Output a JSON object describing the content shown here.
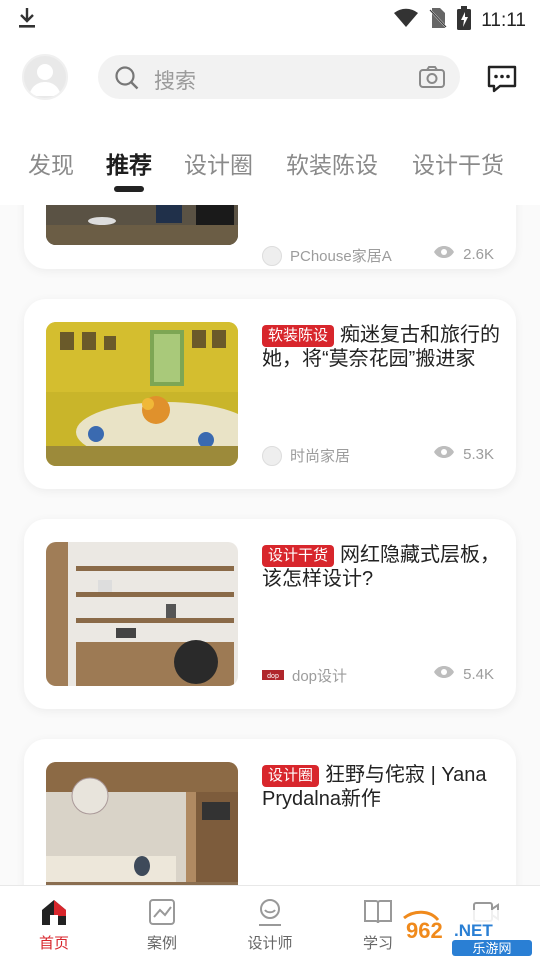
{
  "status_bar": {
    "time": "11:11"
  },
  "header": {
    "search_placeholder": "搜索"
  },
  "tabs": [
    {
      "label": "发现"
    },
    {
      "label": "推荐"
    },
    {
      "label": "设计圈"
    },
    {
      "label": "软装陈设"
    },
    {
      "label": "设计干货"
    }
  ],
  "feed": [
    {
      "source": "PChouse家居A",
      "views": "2.6K"
    },
    {
      "tag": "软装陈设",
      "title": "痴迷复古和旅行的她，将“莫奈花园”搬进家",
      "source": "时尚家居",
      "views": "5.3K"
    },
    {
      "tag": "设计干货",
      "title": "网红隐藏式层板，该怎样设计?",
      "source": "dop设计",
      "views": "5.4K"
    },
    {
      "tag": "设计圈",
      "title": "狂野与侘寂 | Yana Prydalna新作"
    }
  ],
  "bottom_nav": [
    {
      "label": "首页"
    },
    {
      "label": "案例"
    },
    {
      "label": "设计师"
    },
    {
      "label": "学习"
    }
  ],
  "watermark": {
    "text": "962.NET",
    "subtext": "乐游网"
  },
  "colors": {
    "accent": "#d8262c",
    "tab_active": "#1e1e1e",
    "muted": "#9c9c9c"
  }
}
